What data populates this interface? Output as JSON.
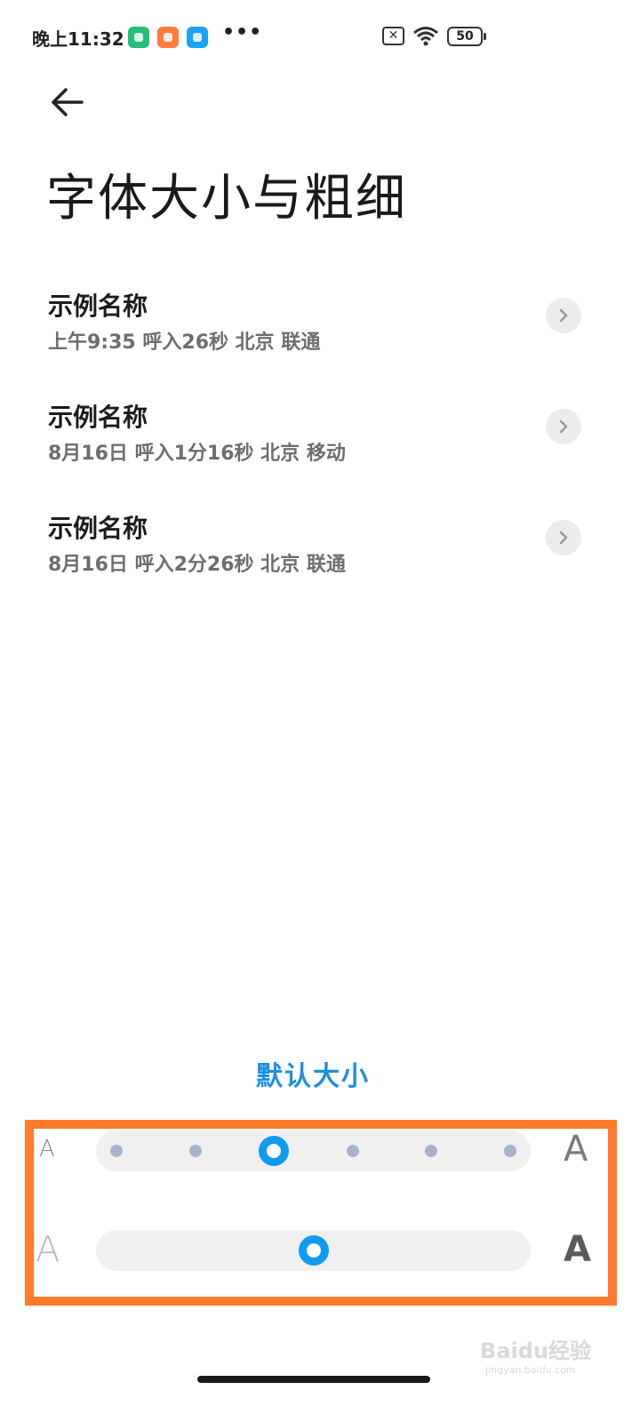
{
  "status_bar": {
    "time": "晚上11:32",
    "more": "•••",
    "sim": "✕",
    "battery": "50"
  },
  "header": {
    "title": "字体大小与粗细"
  },
  "calls": [
    {
      "name": "示例名称",
      "detail": "上午9:35 呼入26秒 北京 联通"
    },
    {
      "name": "示例名称",
      "detail": "8月16日 呼入1分16秒 北京 移动"
    },
    {
      "name": "示例名称",
      "detail": "8月16日 呼入2分26秒 北京 联通"
    }
  ],
  "default_size_label": "默认大小",
  "font_size_slider": {
    "min_label": "A",
    "max_label": "A",
    "steps": 6,
    "selected_step": 3
  },
  "font_weight_slider": {
    "min_label": "A",
    "max_label": "A",
    "value_fraction": 0.5
  },
  "watermark": {
    "brand": "Baidu经验",
    "url": "jingyan.baidu.com"
  },
  "colors": {
    "accent": "#0f9bf0",
    "highlight_border": "#ff7a2a",
    "link": "#1c8fe0"
  }
}
